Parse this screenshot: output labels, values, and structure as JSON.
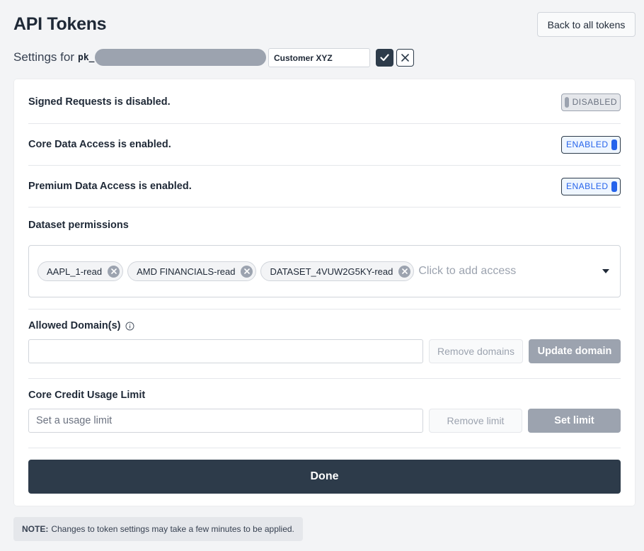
{
  "header": {
    "title": "API Tokens",
    "back_label": "Back to all tokens"
  },
  "settings": {
    "label": "Settings for",
    "key_prefix": "pk_",
    "token_name": "Customer XYZ"
  },
  "toggles": [
    {
      "label": "Signed Requests is disabled.",
      "state": "DISABLED"
    },
    {
      "label": "Core Data Access is enabled.",
      "state": "ENABLED"
    },
    {
      "label": "Premium Data Access is enabled.",
      "state": "ENABLED"
    }
  ],
  "dataset": {
    "label": "Dataset permissions",
    "chips": [
      "AAPL_1-read",
      "AMD FINANCIALS-read",
      "DATASET_4VUW2G5KY-read"
    ],
    "placeholder": "Click to add access"
  },
  "domains": {
    "label": "Allowed Domain(s)",
    "value": "",
    "remove_label": "Remove domains",
    "update_label": "Update domain"
  },
  "usage_limit": {
    "label": "Core Credit Usage Limit",
    "placeholder": "Set a usage limit",
    "remove_label": "Remove limit",
    "set_label": "Set limit"
  },
  "done_label": "Done",
  "note": {
    "prefix": "NOTE:",
    "text": "Changes to token settings may take a few minutes to be applied."
  },
  "colors": {
    "primary": "#2d3b4a",
    "enabled_blue": "#2563eb",
    "muted_grey": "#9ca3af"
  }
}
